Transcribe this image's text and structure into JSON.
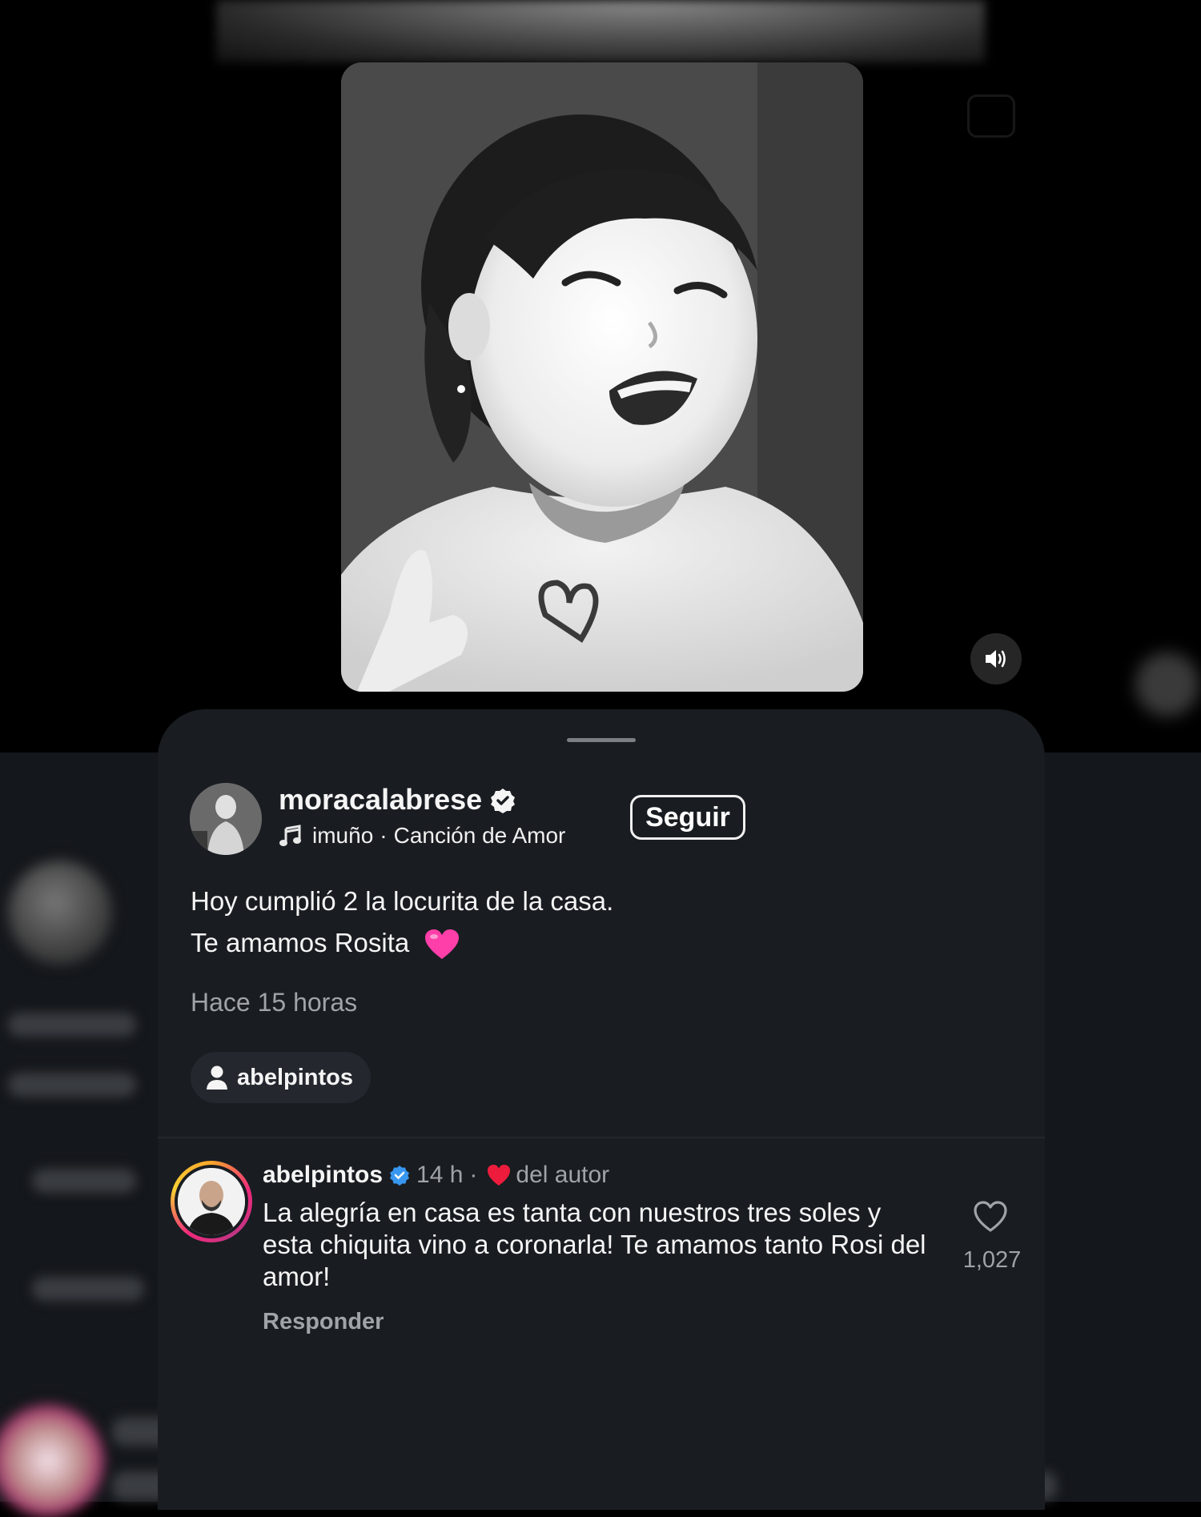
{
  "post": {
    "username": "moracalabrese",
    "music": {
      "artist_partial": "imuño",
      "separator": "·",
      "song": "Canción de Amor"
    },
    "follow_label": "Seguir",
    "caption_line1": "Hoy cumplió 2 la locurita de la casa.",
    "caption_line2": "Te amamos Rosita",
    "time_ago": "Hace 15 horas",
    "tagged_user": "abelpintos"
  },
  "comment": {
    "username": "abelpintos",
    "time": "14 h",
    "separator": "·",
    "author_label": "del autor",
    "text": "La alegría en casa es tanta con nuestros tres soles y esta chiquita vino a coronarla! Te amamos tanto Rosi del amor!",
    "reply_label": "Responder",
    "like_count": "1,027"
  },
  "colors": {
    "sheet_bg": "#191c21",
    "verified_blue": "#3897f0",
    "author_heart_red": "#ed1c3c",
    "caption_heart_pink": "#ff3fa9",
    "muted_text": "#a0a3a8"
  },
  "icons": [
    "verified-badge-icon",
    "music-note-icon",
    "pink-heart-emoji",
    "person-icon",
    "red-heart-icon",
    "like-heart-icon",
    "volume-icon"
  ]
}
